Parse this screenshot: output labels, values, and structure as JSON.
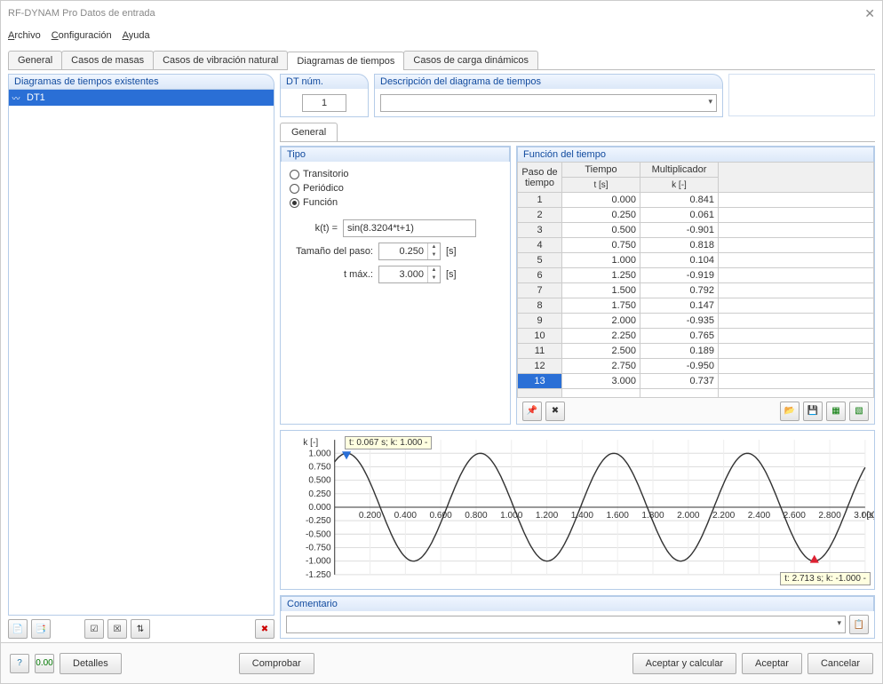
{
  "window_title": "RF-DYNAM Pro Datos de entrada",
  "menu": {
    "file": "Archivo",
    "config": "Configuración",
    "help": "Ayuda"
  },
  "tabs": [
    "General",
    "Casos de masas",
    "Casos de vibración natural",
    "Diagramas de tiempos",
    "Casos de carga dinámicos"
  ],
  "active_tab": 3,
  "left_panel_title": "Diagramas de tiempos existentes",
  "left_items": [
    {
      "name": "DT1",
      "selected": true
    }
  ],
  "dtnum_label": "DT núm.",
  "dtnum_value": "1",
  "desc_label": "Descripción del diagrama de tiempos",
  "desc_value": "",
  "subtab_general": "General",
  "tipo": {
    "title": "Tipo",
    "options": {
      "transitorio": "Transitorio",
      "periodico": "Periódico",
      "funcion": "Función"
    },
    "selected": "funcion",
    "kt_label": "k(t) =",
    "kt_value": "sin(8.3204*t+1)",
    "step_label": "Tamaño del paso:",
    "step_value": "0.250",
    "step_unit": "[s]",
    "tmax_label": "t máx.:",
    "tmax_value": "3.000",
    "tmax_unit": "[s]"
  },
  "func": {
    "title": "Función del tiempo",
    "col_step": "Paso de tiempo",
    "col_t": "Tiempo",
    "col_t_sub": "t [s]",
    "col_k": "Multiplicador",
    "col_k_sub": "k [-]",
    "rows": [
      {
        "step": "1",
        "t": "0.000",
        "k": "0.841"
      },
      {
        "step": "2",
        "t": "0.250",
        "k": "0.061"
      },
      {
        "step": "3",
        "t": "0.500",
        "k": "-0.901"
      },
      {
        "step": "4",
        "t": "0.750",
        "k": "0.818"
      },
      {
        "step": "5",
        "t": "1.000",
        "k": "0.104"
      },
      {
        "step": "6",
        "t": "1.250",
        "k": "-0.919"
      },
      {
        "step": "7",
        "t": "1.500",
        "k": "0.792"
      },
      {
        "step": "8",
        "t": "1.750",
        "k": "0.147"
      },
      {
        "step": "9",
        "t": "2.000",
        "k": "-0.935"
      },
      {
        "step": "10",
        "t": "2.250",
        "k": "0.765"
      },
      {
        "step": "11",
        "t": "2.500",
        "k": "0.189"
      },
      {
        "step": "12",
        "t": "2.750",
        "k": "-0.950"
      },
      {
        "step": "13",
        "t": "3.000",
        "k": "0.737"
      }
    ],
    "selected_row": 12
  },
  "chart_data": {
    "type": "line",
    "title": "",
    "xlabel": "t [s]",
    "ylabel": "k [-]",
    "xlim": [
      0,
      3.0
    ],
    "ylim": [
      -1.25,
      1.25
    ],
    "xticks": [
      0.2,
      0.4,
      0.6,
      0.8,
      1.0,
      1.2,
      1.4,
      1.6,
      1.8,
      2.0,
      2.2,
      2.4,
      2.6,
      2.8,
      3.0
    ],
    "yticks": [
      -1.25,
      -1.0,
      -0.75,
      -0.5,
      -0.25,
      0.0,
      0.25,
      0.5,
      0.75,
      1.0
    ],
    "function": "sin(8.3204*t+1)",
    "markers": [
      {
        "t": 0.067,
        "k": 1.0,
        "label": "t: 0.067 s; k: 1.000 -",
        "kind": "max"
      },
      {
        "t": 2.713,
        "k": -1.0,
        "label": "t: 2.713 s; k: -1.000 -",
        "kind": "min"
      }
    ]
  },
  "comment_title": "Comentario",
  "comment_value": "",
  "footer": {
    "details": "Detalles",
    "check": "Comprobar",
    "accept_calc": "Aceptar y calcular",
    "accept": "Aceptar",
    "cancel": "Cancelar"
  }
}
